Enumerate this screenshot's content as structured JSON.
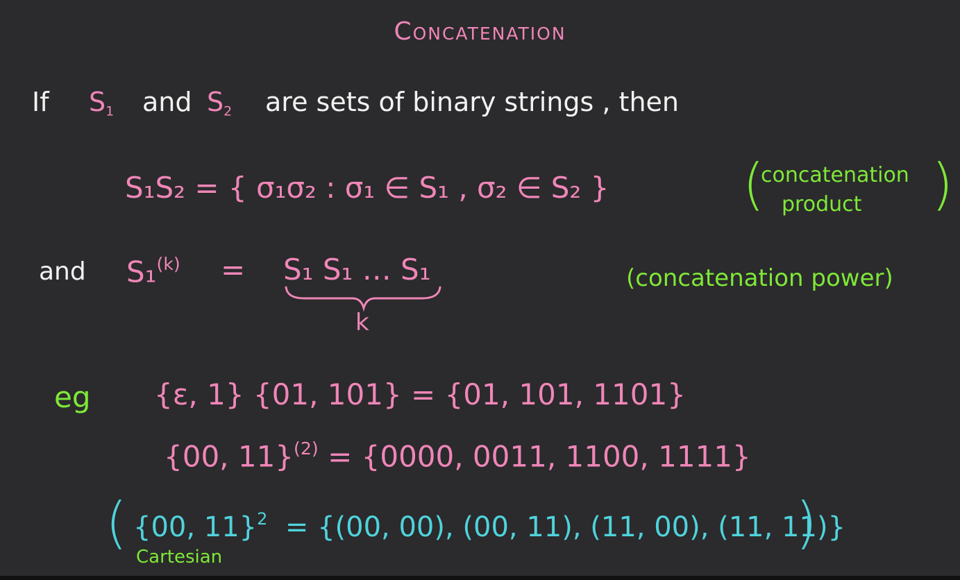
{
  "title": "Concatenation",
  "line1": {
    "if": "If",
    "s1": "S",
    "s1_sub": "1",
    "and": "and",
    "s2": "S",
    "s2_sub": "2",
    "rest": "are   sets   of   binary   strings ,     then"
  },
  "product": {
    "expr": "S₁S₂  =  { σ₁σ₂  :   σ₁ ∈ S₁ ,  σ₂ ∈ S₂ }",
    "annotation_line1": "concatenation",
    "annotation_line2": "product"
  },
  "power": {
    "and": "and",
    "lhs": "S₁",
    "lhs_sup": "(k)",
    "eq": "=",
    "rhs": "S₁ S₁ … S₁",
    "brace_label": "k",
    "annotation": "(concatenation power)"
  },
  "examples": {
    "eg": "eg",
    "ex1": "{ε, 1} {01, 101}   =  {01, 101, 1101}",
    "ex2_lhs": "{00, 11}",
    "ex2_sup": "(2)",
    "ex2_rhs": "=  {0000, 0011, 1100, 1111}",
    "ex3_lhs": "{00, 11}",
    "ex3_sup": "2",
    "ex3_rhs": "=   {(00, 00), (00, 11), (11, 00), (11, 11)}",
    "ex3_label": "Cartesian"
  },
  "colors": {
    "background": "#2b2a2c",
    "pink": "#ef86b8",
    "white": "#f2f2f2",
    "green": "#7ee838",
    "cyan": "#4fd3dc"
  }
}
